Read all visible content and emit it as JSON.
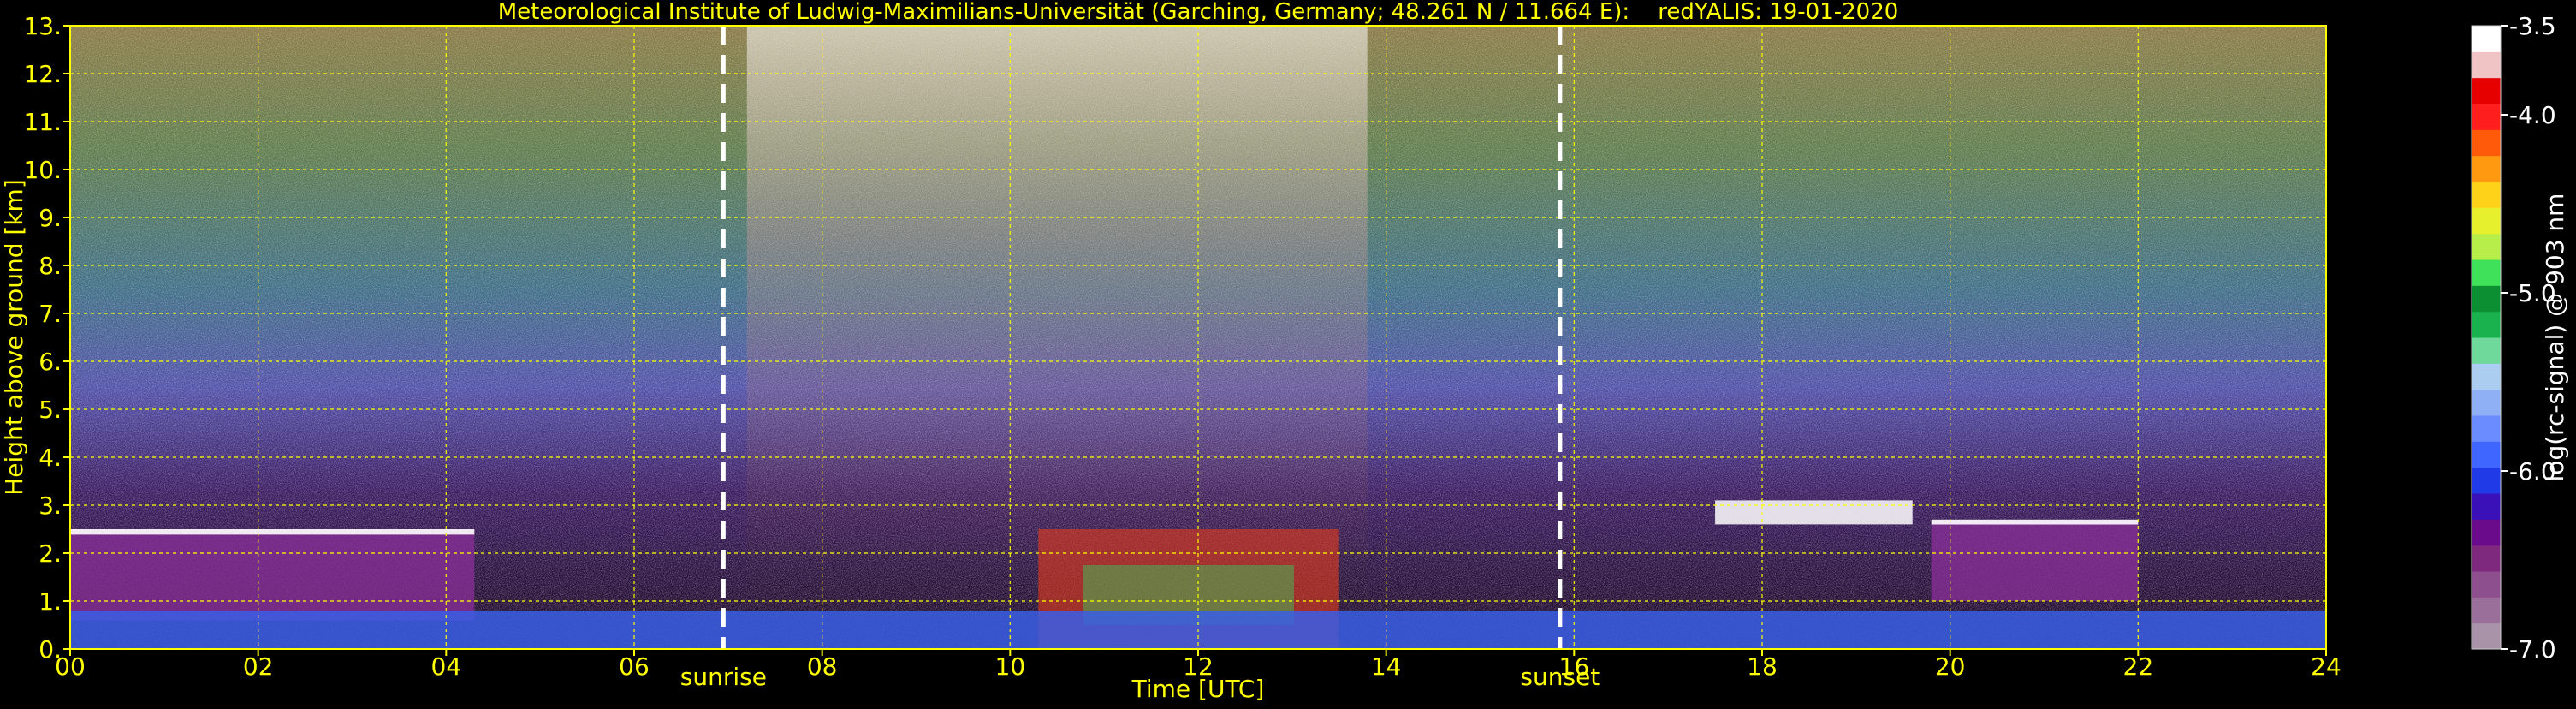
{
  "chart_data": {
    "type": "heatmap",
    "title": "Meteorological Institute of Ludwig-Maximilians-Universität (Garching, Germany; 48.261 N / 11.664 E):    redYALIS: 19-01-2020",
    "xlabel": "Time [UTC]",
    "ylabel": "Height above ground [km]",
    "xlim": [
      0,
      24
    ],
    "ylim": [
      0.0,
      13.0
    ],
    "x_ticks": [
      0,
      2,
      4,
      6,
      8,
      10,
      12,
      14,
      16,
      18,
      20,
      22,
      24
    ],
    "x_tick_labels": [
      "00",
      "02",
      "04",
      "06",
      "08",
      "10",
      "12",
      "14",
      "16",
      "18",
      "20",
      "22",
      "24"
    ],
    "y_ticks": [
      0,
      1,
      2,
      3,
      4,
      5,
      6,
      7,
      8,
      9,
      10,
      11,
      12,
      13
    ],
    "y_tick_labels": [
      "0.",
      "1.",
      "2.",
      "3.",
      "4.",
      "5.",
      "6.",
      "7.",
      "8.",
      "9.",
      "10.",
      "11.",
      "12.",
      "13."
    ],
    "grid": true,
    "annotations": [
      {
        "text": "sunrise",
        "x": 6.95
      },
      {
        "text": "sunset",
        "x": 15.85
      }
    ],
    "colorbar": {
      "label": "log(rc-signal) @ 903 nm",
      "range": [
        -7.0,
        -3.5
      ],
      "ticks": [
        -3.5,
        -4.0,
        -5.0,
        -6.0,
        -7.0
      ],
      "tick_labels": [
        "-3.5",
        "-4.0",
        "-5.0",
        "-6.0",
        "-7.0"
      ],
      "colors": [
        "#a893a8",
        "#9a6f9a",
        "#8e4f8e",
        "#7e287e",
        "#6a0b8c",
        "#3a10b8",
        "#1f3ae6",
        "#3f66ff",
        "#6a8cff",
        "#8fb0f5",
        "#aacdf0",
        "#6fd99c",
        "#19b24e",
        "#0c8f33",
        "#3fe15a",
        "#b7ee4a",
        "#e7f02d",
        "#ffd21a",
        "#ff9a10",
        "#ff5a0a",
        "#ff1e1e",
        "#e60000",
        "#f0c4c4",
        "#ffffff"
      ]
    },
    "features": [
      {
        "name": "cloud_layer",
        "x_start": 0.0,
        "x_end": 4.3,
        "base": 0.6,
        "top": 2.5
      },
      {
        "name": "cloud_layer",
        "x_start": 19.8,
        "x_end": 22.0,
        "base": 1.0,
        "top": 2.7
      },
      {
        "name": "cloud_fragment",
        "x_start": 17.5,
        "x_end": 19.6,
        "base": 2.6,
        "top": 3.1
      },
      {
        "name": "strong_return",
        "x_start": 10.3,
        "x_end": 13.5,
        "base": 0.0,
        "top": 2.5
      },
      {
        "name": "boundary_layer",
        "x_start": 0.0,
        "x_end": 24.0,
        "base": 0.0,
        "top": 0.8
      }
    ]
  }
}
